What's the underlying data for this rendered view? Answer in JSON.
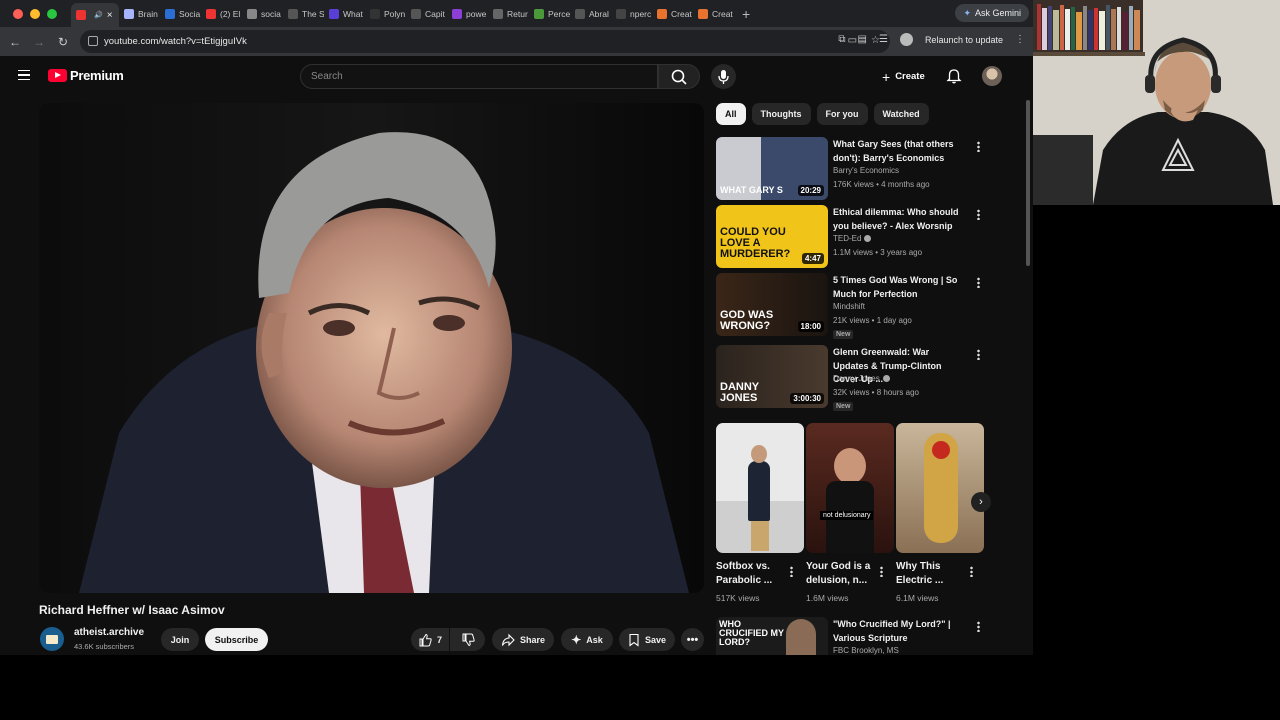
{
  "browser": {
    "tabs": [
      {
        "label": "",
        "color": "#e33"
      },
      {
        "label": "Brain",
        "color": "#a6b4ff"
      },
      {
        "label": "Socia",
        "color": "#2b6fd6"
      },
      {
        "label": "(2) El",
        "color": "#e33"
      },
      {
        "label": "socia",
        "color": "#888"
      },
      {
        "label": "The S",
        "color": "#555"
      },
      {
        "label": "What",
        "color": "#5a3fd6"
      },
      {
        "label": "Polyn",
        "color": "#333"
      },
      {
        "label": "Capit",
        "color": "#555"
      },
      {
        "label": "powe",
        "color": "#8b3fd6"
      },
      {
        "label": "Retur",
        "color": "#666"
      },
      {
        "label": "Perce",
        "color": "#4a9a3a"
      },
      {
        "label": "Abral",
        "color": "#555"
      },
      {
        "label": "nperc",
        "color": "#444"
      },
      {
        "label": "Creat",
        "color": "#e8732e"
      },
      {
        "label": "Creat",
        "color": "#e8732e"
      }
    ],
    "ask_gemini": "Ask Gemini",
    "url": "youtube.com/watch?v=tEtigjguIVk",
    "relaunch": "Relaunch to update"
  },
  "youtube": {
    "logo_text": "Premium",
    "search_placeholder": "Search",
    "create_label": "Create"
  },
  "video": {
    "title": "Richard Heffner w/ Isaac Asimov",
    "channel": "atheist.archive",
    "subscribers": "43.6K subscribers",
    "join_label": "Join",
    "subscribe_label": "Subscribe",
    "likes": "7",
    "share_label": "Share",
    "ask_label": "Ask",
    "save_label": "Save"
  },
  "filters": [
    "All",
    "Thoughts",
    "For you",
    "Watched"
  ],
  "recommendations": [
    {
      "title": "What Gary Sees (that others don't): Barry's Economics",
      "channel": "Barry's Economics",
      "meta": "176K views • 4 months ago",
      "duration": "20:29",
      "thumb_text": "WHAT GARY S",
      "verified": false,
      "new": ""
    },
    {
      "title": "Ethical dilemma: Who should you believe? - Alex Worsnip",
      "channel": "TED-Ed",
      "meta": "1.1M views • 3 years ago",
      "duration": "4:47",
      "thumb_text": "COULD YOU LOVE A MURDERER?",
      "verified": true,
      "new": ""
    },
    {
      "title": "5 Times God Was Wrong | So Much for Perfection",
      "channel": "Mindshift",
      "meta": "21K views • 1 day ago",
      "duration": "18:00",
      "thumb_text": "GOD WAS WRONG?",
      "verified": false,
      "new": "New"
    },
    {
      "title": "Glenn Greenwald: War Updates & Trump-Clinton Cover Up ...",
      "channel": "Danny Jones",
      "meta": "32K views • 8 hours ago",
      "duration": "3:00:30",
      "thumb_text": "DANNY JONES",
      "verified": true,
      "new": "New"
    }
  ],
  "shorts": [
    {
      "title": "Softbox vs. Parabolic ...",
      "views": "517K views",
      "overlay": ""
    },
    {
      "title": "Your God is a delusion, n...",
      "views": "1.6M views",
      "overlay": "not delusionary"
    },
    {
      "title": "Why This Electric ...",
      "views": "6.1M views",
      "overlay": ""
    }
  ],
  "bottom_rec": {
    "title": "\"Who Crucified My Lord?\" | Various Scripture",
    "channel": "FBC Brooklyn, MS",
    "thumb_text": "WHO CRUCIFIED MY LORD?"
  }
}
